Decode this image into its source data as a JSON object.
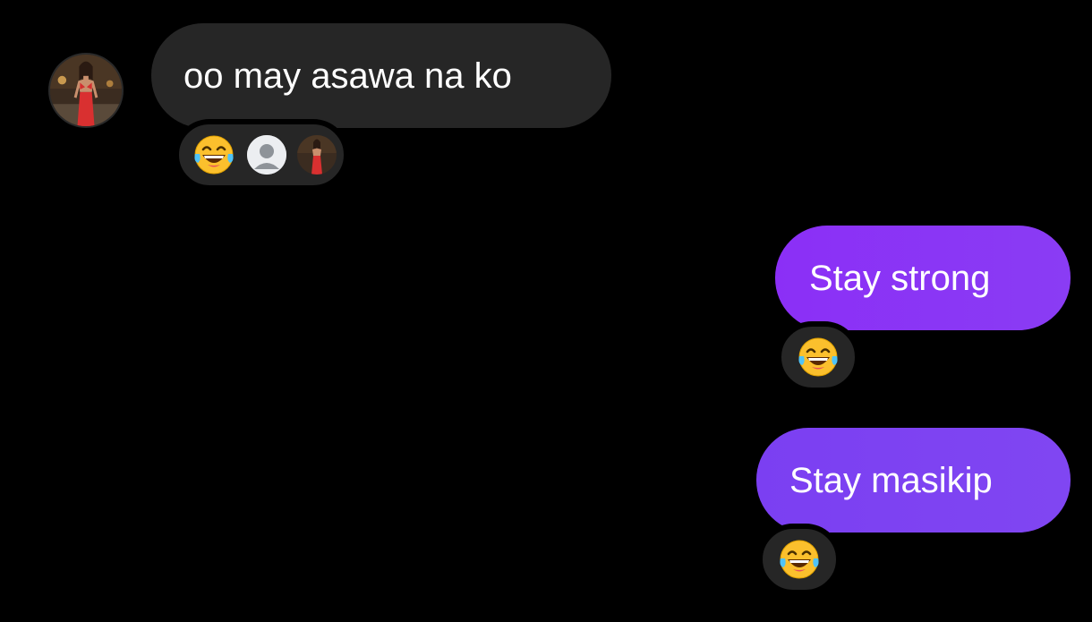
{
  "messages": [
    {
      "direction": "incoming",
      "text": "oo may asawa na ko",
      "reactions": [
        "laughing-tears-emoji",
        "default-user-avatar",
        "contact-avatar"
      ]
    },
    {
      "direction": "outgoing",
      "text": "Stay strong",
      "reactions": [
        "laughing-tears-emoji"
      ]
    },
    {
      "direction": "outgoing",
      "text": "Stay masikip",
      "reactions": [
        "laughing-tears-emoji"
      ]
    }
  ],
  "colors": {
    "background": "#000000",
    "incoming_bubble": "#262626",
    "outgoing_bubble": "#8a3cf5",
    "reaction_pill": "#262626",
    "text": "#ffffff"
  }
}
